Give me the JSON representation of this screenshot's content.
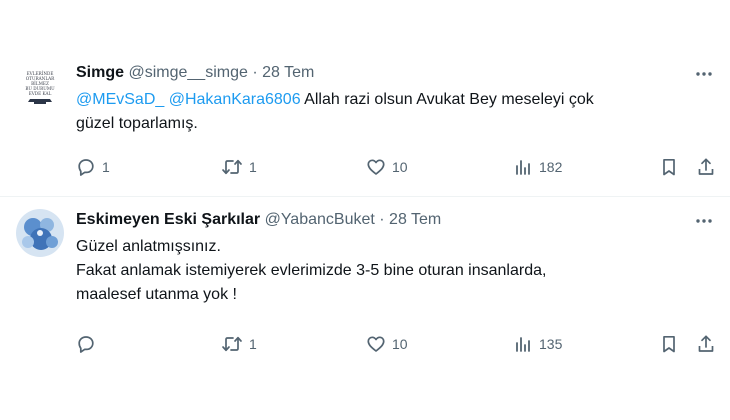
{
  "tweets": [
    {
      "author": {
        "display_name": "Simge",
        "handle": "@simge__simge",
        "separator": "·",
        "date": "28 Tem",
        "avatar": {
          "lines": [
            "EVLERİNDE",
            "OTURANLAR",
            "BİLMEZ",
            "BU DURUMU",
            "EVDE KAL"
          ]
        }
      },
      "content": {
        "line1": {
          "mention1": "@MEvSaD_",
          "mention2": "@HakanKara6806",
          "text": " Allah razi olsun Avukat Bey meseleyi çok"
        },
        "line2": "güzel toparlamış."
      },
      "actions": {
        "replies": "1",
        "reposts": "1",
        "likes": "10",
        "views": "182"
      }
    },
    {
      "author": {
        "display_name": "Eskimeyen Eski Şarkılar",
        "handle": "@YabancBuket",
        "separator": "·",
        "date": "28 Tem",
        "avatar": {
          "lines": []
        }
      },
      "content": {
        "line1": "Güzel anlatmışsınız.",
        "line2": "Fakat anlamak istemiyerek evlerimizde 3-5 bine oturan insanlarda,",
        "line3": "maalesef utanma yok !"
      },
      "actions": {
        "replies": "",
        "reposts": "1",
        "likes": "10",
        "views": "135"
      }
    }
  ],
  "icons": {
    "more": "more-horizontal-icon",
    "reply": "reply-icon",
    "repost": "repost-icon",
    "like": "like-icon",
    "views": "views-icon",
    "bookmark": "bookmark-icon",
    "share": "share-icon"
  },
  "colors": {
    "text": "#0f1419",
    "secondary": "#536471",
    "mention": "#1d9bf0",
    "divider": "#eff3f4"
  }
}
